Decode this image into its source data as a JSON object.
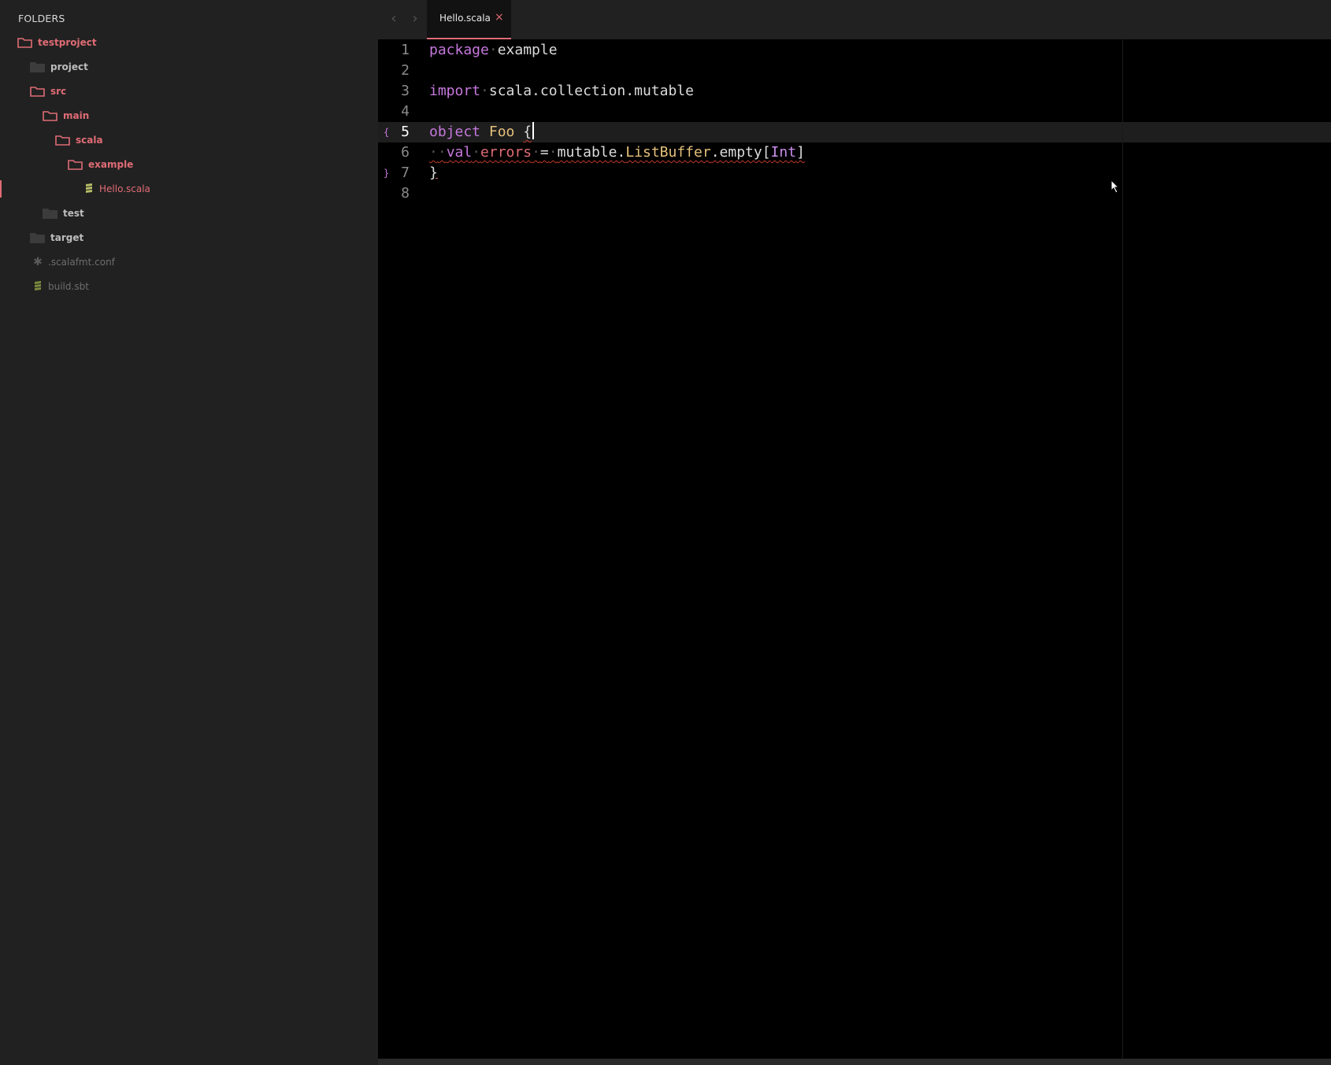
{
  "sidebar": {
    "title": "FOLDERS",
    "tree": [
      {
        "label": "testproject",
        "kind": "folder-open"
      },
      {
        "label": "project",
        "kind": "folder-closed"
      },
      {
        "label": "src",
        "kind": "folder-open"
      },
      {
        "label": "main",
        "kind": "folder-open"
      },
      {
        "label": "scala",
        "kind": "folder-open"
      },
      {
        "label": "example",
        "kind": "folder-open"
      },
      {
        "label": "Hello.scala",
        "kind": "file-active",
        "icon": "scala-file-icon"
      },
      {
        "label": "test",
        "kind": "folder-closed"
      },
      {
        "label": "target",
        "kind": "folder-closed"
      },
      {
        "label": ".scalafmt.conf",
        "kind": "file-dim",
        "icon": "asterisk-icon"
      },
      {
        "label": "build.sbt",
        "kind": "file-dim",
        "icon": "scala-file-icon"
      }
    ]
  },
  "tabs": {
    "back_icon": "chevron-left-icon",
    "forward_icon": "chevron-right-icon",
    "active": {
      "label": "Hello.scala",
      "close": "×"
    }
  },
  "editor": {
    "line_numbers": [
      "1",
      "2",
      "3",
      "4",
      "5",
      "6",
      "7",
      "8"
    ],
    "current_line": "5",
    "fold_open": "{",
    "fold_close": "}",
    "code": {
      "l1": {
        "kw": "package",
        "name": "example"
      },
      "l3": {
        "kw": "import",
        "path": "scala.collection.mutable"
      },
      "l5": {
        "kw": "object",
        "name": "Foo",
        "brace": "{"
      },
      "l6": {
        "kw": "val",
        "name": "errors",
        "eq": "=",
        "recv": "mutable.",
        "cls": "ListBuffer",
        "method": ".empty[",
        "type": "Int",
        "close": "]"
      },
      "l7": {
        "brace": "}"
      }
    },
    "whitespace_dot": "·"
  },
  "colors": {
    "accent": "#e06c75",
    "keyword": "#c678dd",
    "class": "#e5c07b",
    "sidebar_bg": "#212121",
    "editor_bg": "#000000"
  }
}
